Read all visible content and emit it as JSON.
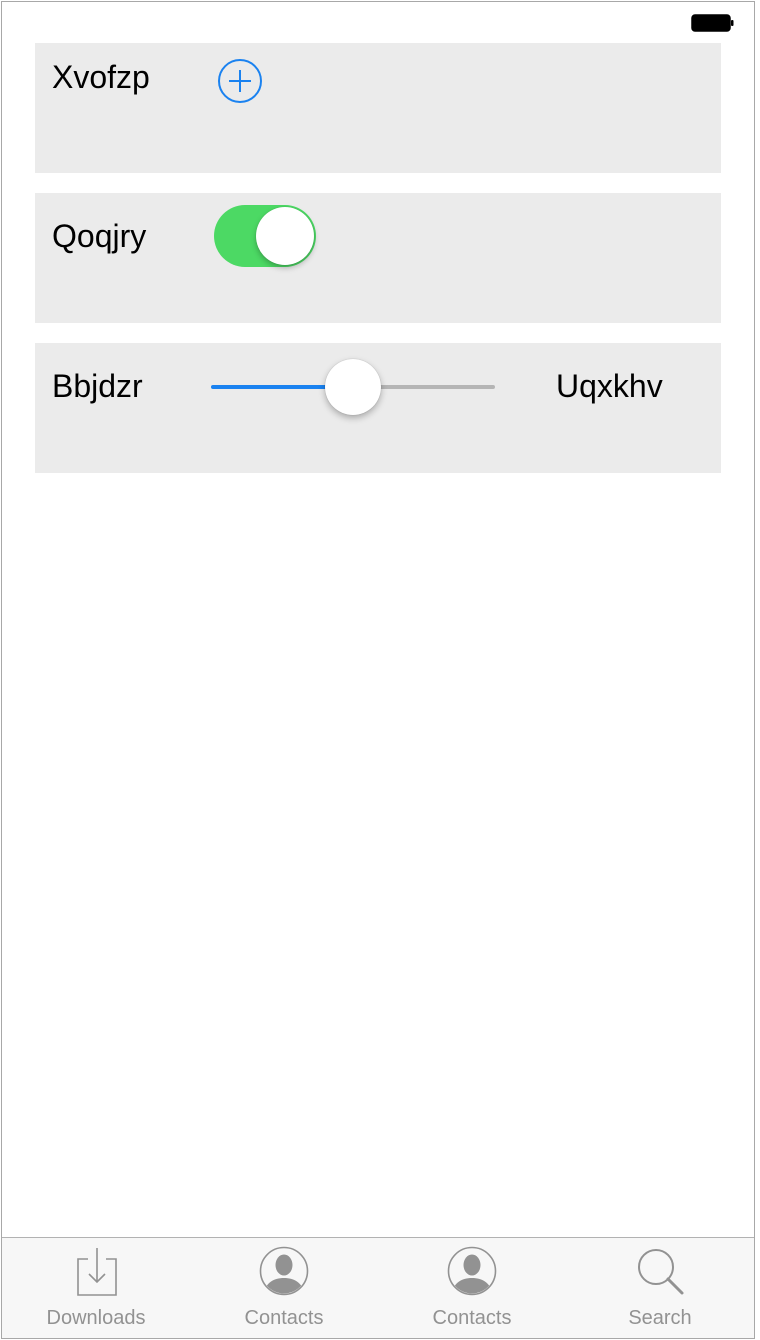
{
  "status_bar": {
    "battery_icon": "battery-full-icon"
  },
  "rows": [
    {
      "label": "Xvofzp",
      "control": "add-button",
      "icon": "plus-circle-icon"
    },
    {
      "label": "Qoqjry",
      "control": "toggle",
      "toggle_on": true
    },
    {
      "label": "Bbjdzr",
      "control": "slider",
      "slider_value": 0.5,
      "trailing_label": "Uqxkhv"
    }
  ],
  "tab_bar": {
    "items": [
      {
        "label": "Downloads",
        "icon": "download-tray-icon"
      },
      {
        "label": "Contacts",
        "icon": "person-circle-icon"
      },
      {
        "label": "Contacts",
        "icon": "person-circle-icon"
      },
      {
        "label": "Search",
        "icon": "magnifier-icon"
      }
    ]
  },
  "colors": {
    "accent_blue": "#1a82f0",
    "toggle_on_green": "#4cd964",
    "row_background": "#ebebeb",
    "tab_label_gray": "#929292"
  }
}
